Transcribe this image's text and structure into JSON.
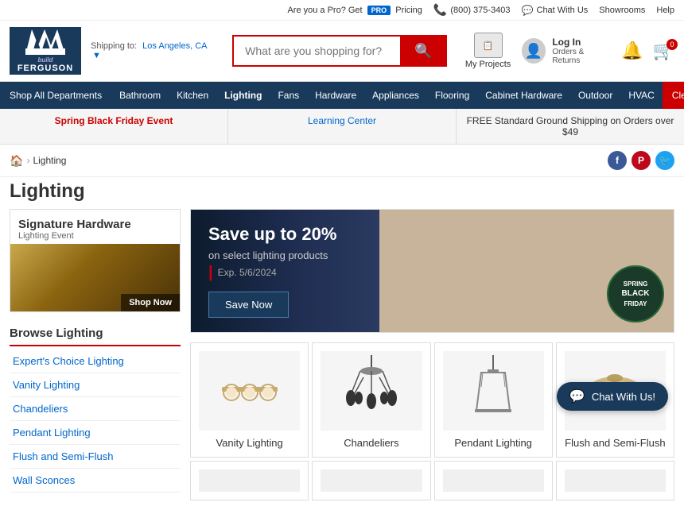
{
  "topBar": {
    "proText": "Are you a Pro? Get",
    "proLink": "PRO",
    "pricingText": "Pricing",
    "phone": "(800) 375-3403",
    "chat": "Chat With Us",
    "showrooms": "Showrooms",
    "help": "Help"
  },
  "header": {
    "logoLine1": "build",
    "logoLine2": "FERGUSON",
    "shipping": "Shipping to:",
    "shippingCity": "Los Angeles, CA",
    "searchPlaceholder": "What are you shopping for?",
    "myProjects": "My Projects",
    "logIn": "Log In",
    "ordersReturns": "Orders & Returns"
  },
  "nav": {
    "items": [
      {
        "label": "Shop All Departments"
      },
      {
        "label": "Bathroom"
      },
      {
        "label": "Kitchen"
      },
      {
        "label": "Lighting"
      },
      {
        "label": "Fans"
      },
      {
        "label": "Hardware"
      },
      {
        "label": "Appliances"
      },
      {
        "label": "Flooring"
      },
      {
        "label": "Cabinet Hardware"
      },
      {
        "label": "Outdoor"
      },
      {
        "label": "HVAC"
      },
      {
        "label": "Clearance"
      }
    ]
  },
  "bannerBar": {
    "items": [
      {
        "label": "Spring Black Friday Event",
        "type": "red"
      },
      {
        "label": "Learning Center",
        "type": "link"
      },
      {
        "label": "FREE Standard Ground Shipping on Orders over $49",
        "type": "link"
      }
    ]
  },
  "breadcrumb": {
    "home": "Home",
    "current": "Lighting"
  },
  "pageTitle": "Lighting",
  "social": {
    "facebook": "f",
    "pinterest": "p",
    "twitter": "t"
  },
  "sidebar": {
    "promoTitle": "Signature Hardware",
    "promoSub": "Lighting Event",
    "shopNowLabel": "Shop Now",
    "browseTitle": "Browse Lighting",
    "navItems": [
      {
        "label": "Expert's Choice Lighting"
      },
      {
        "label": "Vanity Lighting"
      },
      {
        "label": "Chandeliers"
      },
      {
        "label": "Pendant Lighting"
      },
      {
        "label": "Flush and Semi-Flush"
      },
      {
        "label": "Wall Sconces"
      }
    ]
  },
  "promoBanner": {
    "title": "Save up to 20%",
    "sub": "on select lighting products",
    "exp": "Exp. 5/6/2024",
    "btnLabel": "Save Now",
    "badgeLine1": "SPRING",
    "badgeLine2": "BLACK",
    "badgeLine3": "FRIDAY"
  },
  "products": {
    "row1": [
      {
        "label": "Vanity Lighting"
      },
      {
        "label": "Chandeliers"
      },
      {
        "label": "Pendant Lighting"
      },
      {
        "label": "Flush and Semi-Flush"
      }
    ],
    "row2": [
      {
        "label": ""
      },
      {
        "label": ""
      },
      {
        "label": ""
      },
      {
        "label": ""
      }
    ]
  }
}
